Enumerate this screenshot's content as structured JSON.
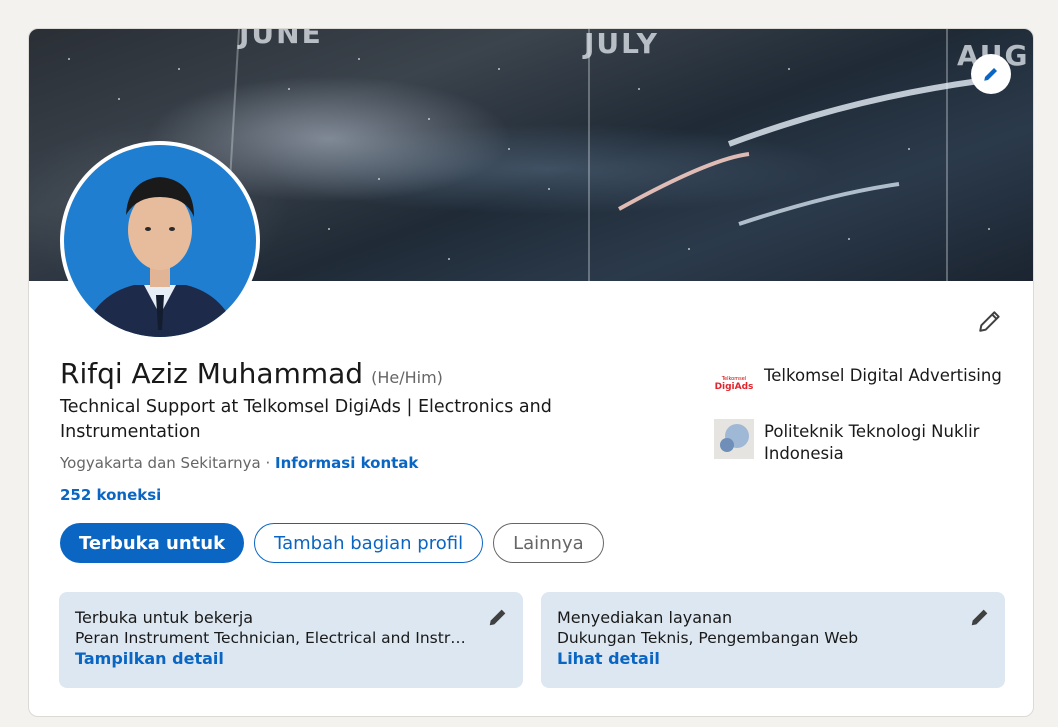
{
  "banner": {
    "months": [
      "JUNE",
      "JULY",
      "AUG"
    ]
  },
  "profile": {
    "name": "Rifqi Aziz Muhammad",
    "pronouns": "(He/Him)",
    "headline": "Technical Support at Telkomsel DigiAds | Electronics and Instrumentation",
    "location": "Yogyakarta dan Sekitarnya",
    "location_separator": " · ",
    "contact_link": "Informasi kontak",
    "connections": "252 koneksi"
  },
  "buttons": {
    "open_to": "Terbuka untuk",
    "add_section": "Tambah bagian profil",
    "more": "Lainnya"
  },
  "organizations": [
    {
      "name": "Telkomsel Digital Advertising",
      "logo_text": "DigiAds",
      "logo_small_text": "Telkomsel",
      "icon": "telkomsel-digiads-logo"
    },
    {
      "name": "Politeknik Teknologi Nuklir Indonesia",
      "icon": "politeknik-logo"
    }
  ],
  "panels": [
    {
      "title": "Terbuka untuk bekerja",
      "description": "Peran Instrument Technician, Electrical and Instru…",
      "link": "Tampilkan detail"
    },
    {
      "title": "Menyediakan layanan",
      "description": "Dukungan Teknis, Pengembangan Web",
      "link": "Lihat detail"
    }
  ],
  "colors": {
    "accent": "#0a66c2",
    "panel_bg": "#dde7f1",
    "avatar_bg": "#1f7ed0",
    "page_bg": "#f3f2ef"
  }
}
